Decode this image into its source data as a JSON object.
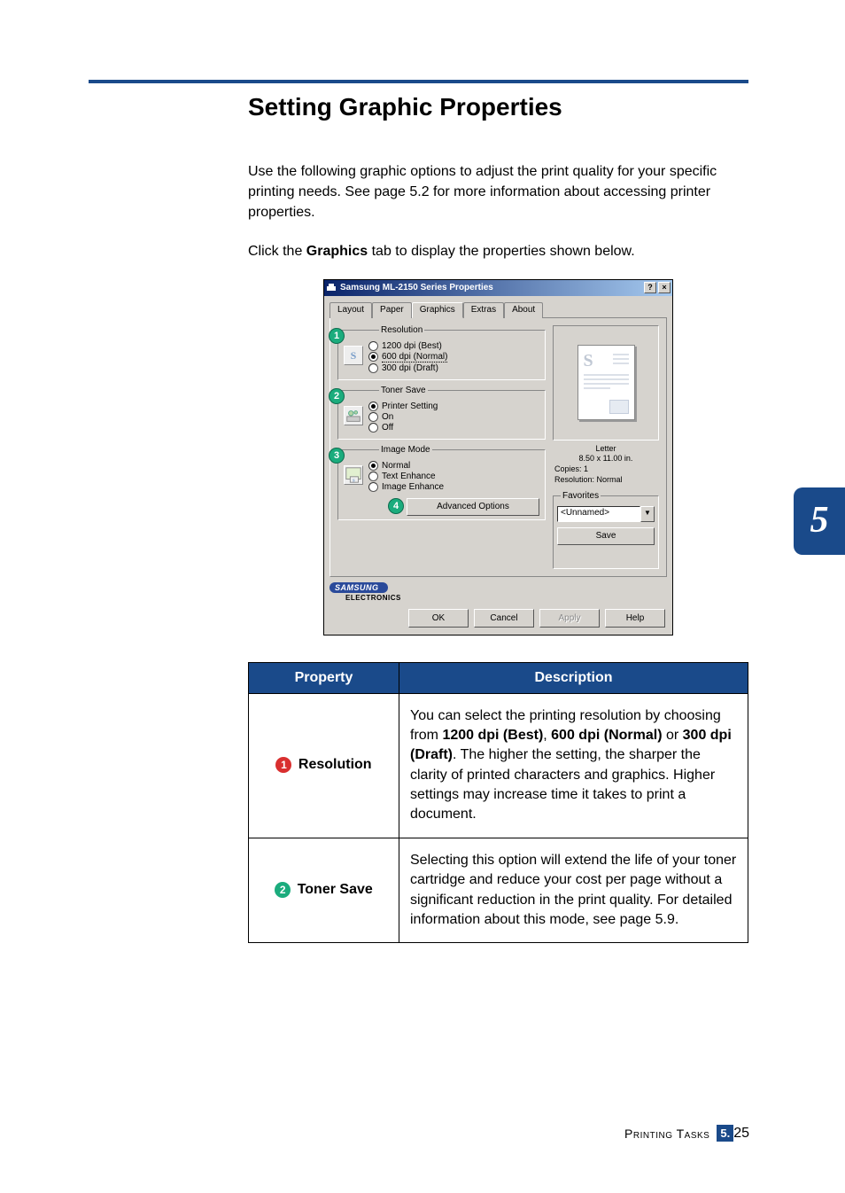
{
  "heading": "Setting Graphic Properties",
  "intro_p1": "Use the following graphic options to adjust the print quality for your specific printing needs. See page 5.2 for more information about accessing printer properties.",
  "intro_p2_pre": "Click the ",
  "intro_p2_bold": "Graphics",
  "intro_p2_post": " tab to display the properties shown below.",
  "dialog": {
    "title": "Samsung ML-2150 Series Properties",
    "help_btn": "?",
    "close_btn": "×",
    "tabs": {
      "layout": "Layout",
      "paper": "Paper",
      "graphics": "Graphics",
      "extras": "Extras",
      "about": "About"
    },
    "resolution": {
      "legend": "Resolution",
      "opt1": "1200 dpi (Best)",
      "opt2": "600 dpi (Normal)",
      "opt3": "300 dpi (Draft)",
      "icon": "S"
    },
    "tonersave": {
      "legend": "Toner Save",
      "opt1": "Printer Setting",
      "opt2": "On",
      "opt3": "Off"
    },
    "imagemode": {
      "legend": "Image Mode",
      "opt1": "Normal",
      "opt2": "Text Enhance",
      "opt3": "Image Enhance"
    },
    "advanced_btn": "Advanced Options",
    "preview": {
      "paper_name": "Letter",
      "paper_size": "8.50 x 11.00 in.",
      "copies": "Copies: 1",
      "resolution": "Resolution: Normal"
    },
    "favorites": {
      "legend": "Favorites",
      "value": "<Unnamed>",
      "save": "Save"
    },
    "brand1": "SAMSUNG",
    "brand2": "ELECTRONICS",
    "btn_ok": "OK",
    "btn_cancel": "Cancel",
    "btn_apply": "Apply",
    "btn_help": "Help"
  },
  "callouts": {
    "c1": "1",
    "c2": "2",
    "c3": "3",
    "c4": "4"
  },
  "table": {
    "h_property": "Property",
    "h_description": "Description",
    "row1": {
      "num": "1",
      "name": "Resolution",
      "d1": "You can select the printing resolution by choosing from ",
      "d2": "1200 dpi (Best)",
      "d3": ", ",
      "d4": "600 dpi (Normal)",
      "d5": " or ",
      "d6": "300 dpi (Draft)",
      "d7": ". The higher the setting, the sharper the clarity of printed characters and graphics. Higher settings may increase time it takes to print a document."
    },
    "row2": {
      "num": "2",
      "name": "Toner Save",
      "desc": "Selecting this option will extend the life of your toner cartridge and reduce your cost per page without a significant reduction in the print quality. For detailed information about this mode, see page 5.9."
    }
  },
  "side_tab": "5",
  "footer": {
    "section": "Printing Tasks",
    "page_major": "5.",
    "page_minor": "25"
  }
}
